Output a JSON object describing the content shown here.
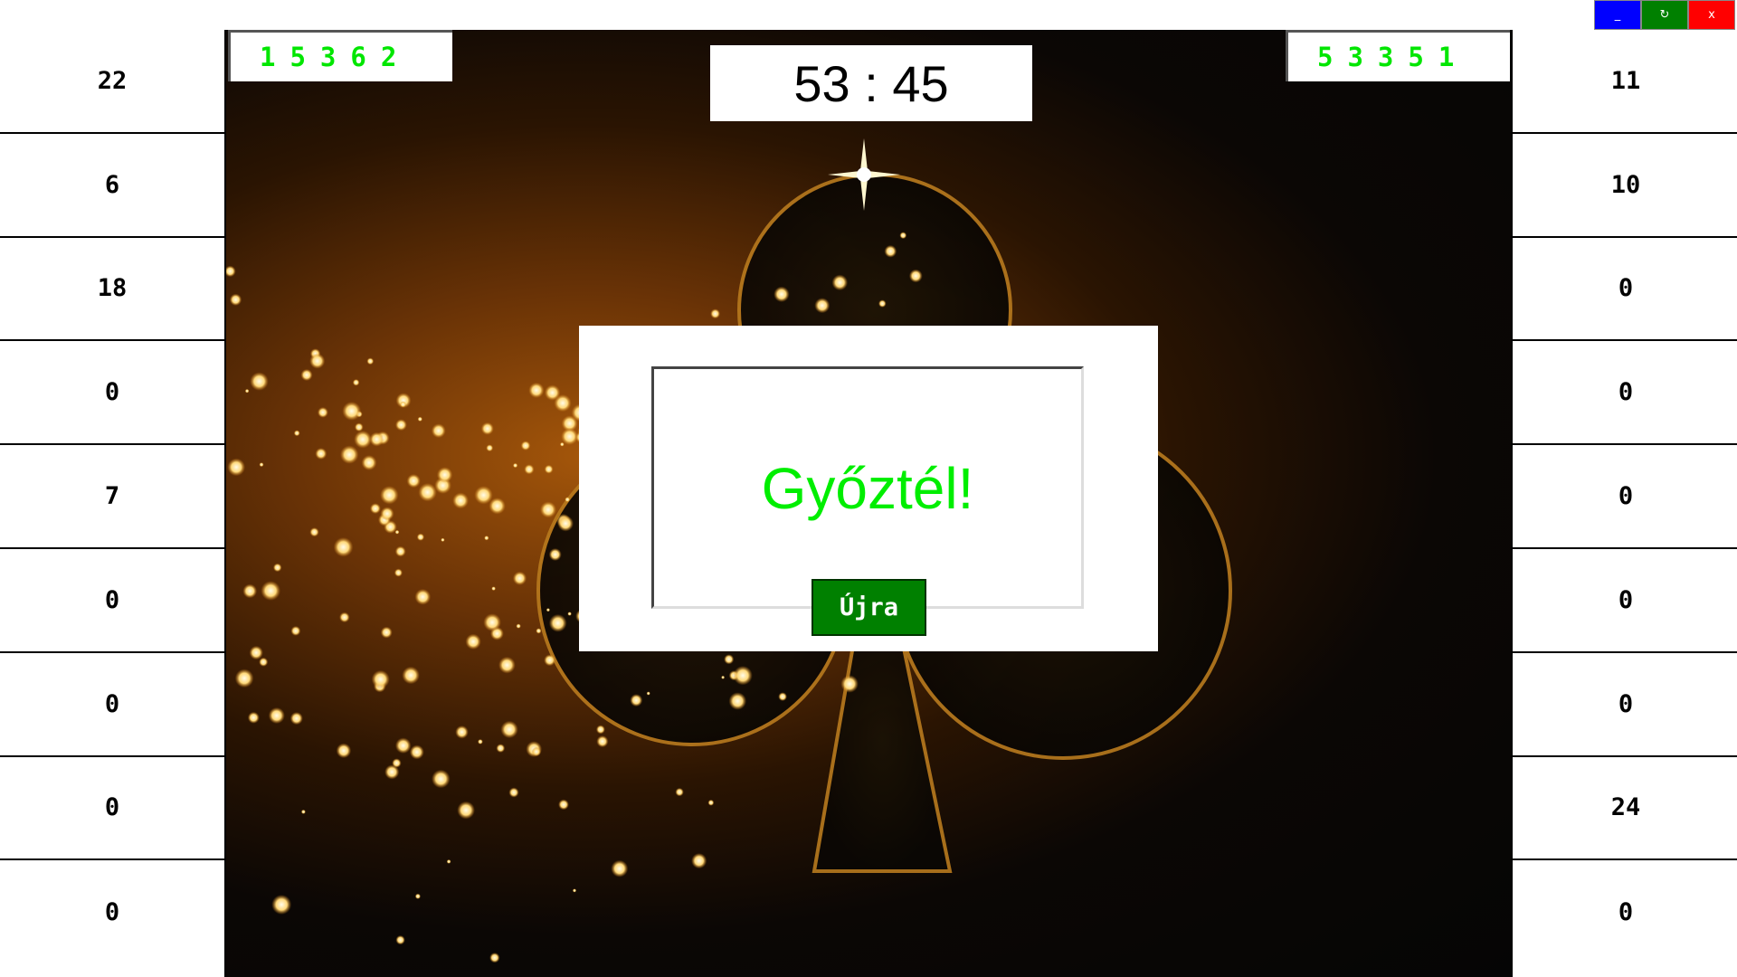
{
  "window_controls": {
    "minimize_label": "_",
    "refresh_label": "↻",
    "close_label": "x"
  },
  "left_column": [
    "22",
    "6",
    "18",
    "0",
    "7",
    "0",
    "0",
    "0",
    "0"
  ],
  "right_column": [
    "11",
    "10",
    "0",
    "0",
    "0",
    "0",
    "0",
    "24",
    "0"
  ],
  "left_sequence": "15362",
  "right_sequence": "53351",
  "timer": "53 : 45",
  "dialog": {
    "message": "Győztél!",
    "button_label": "Újra"
  },
  "colors": {
    "sequence_text": "#00e600",
    "message_text": "#00ee00",
    "again_button": "#008000",
    "minimize_button": "#0000ff",
    "refresh_button": "#008000",
    "close_button": "#ff0000"
  },
  "background_image": "club-suit-golden-sparkles"
}
